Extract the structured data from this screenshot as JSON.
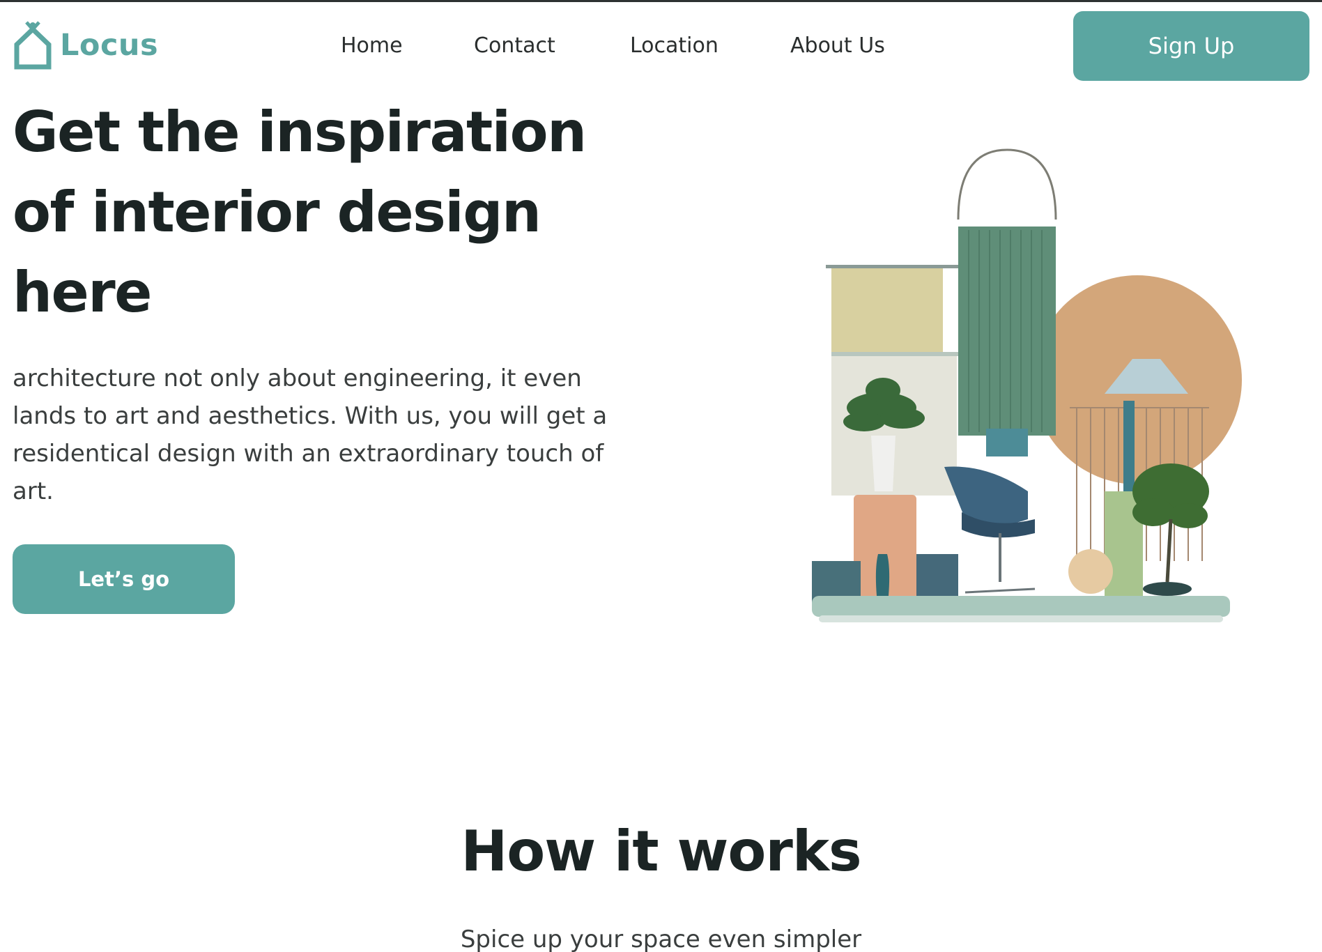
{
  "brand": {
    "name": "Locus",
    "accent_color": "#5ba6a1",
    "logo_icon": "house-icon"
  },
  "nav": {
    "items": [
      {
        "label": "Home"
      },
      {
        "label": "Contact"
      },
      {
        "label": "Location"
      },
      {
        "label": "About Us"
      }
    ],
    "signup_label": "Sign Up"
  },
  "hero": {
    "title": "Get the inspiration of interior design here",
    "description": "architecture not only about engineering, it even lands to art and aesthetics. With us, you will get a residentical design with an extraordinary touch of art.",
    "cta_label": "Let’s go",
    "illustration": "interior-design-illustration"
  },
  "how_it_works": {
    "title": "How it works",
    "subtitle": "Spice up your space even simpler"
  }
}
